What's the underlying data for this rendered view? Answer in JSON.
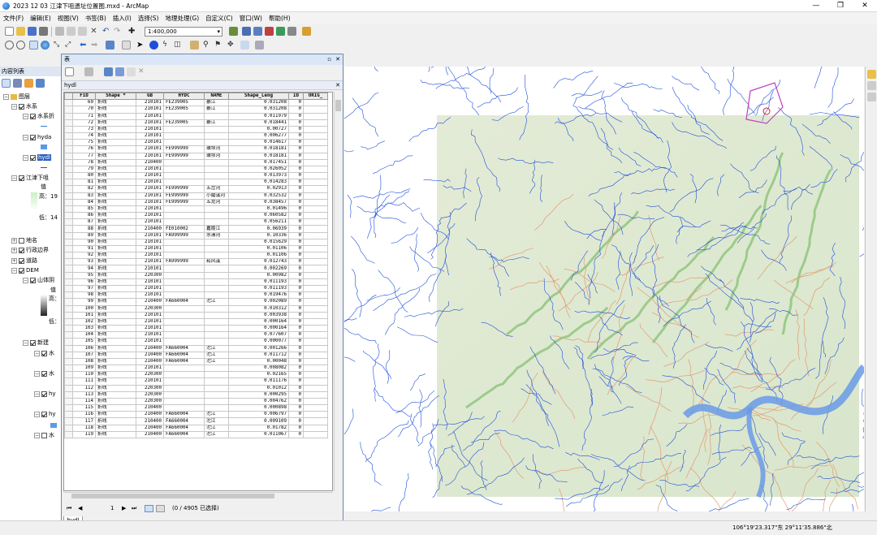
{
  "window": {
    "title": "2023 12 03 江津下咀遗址位置图.mxd - ArcMap"
  },
  "menu": [
    "文件(F)",
    "编辑(E)",
    "视图(V)",
    "书签(B)",
    "插入(I)",
    "选择(S)",
    "地理处理(G)",
    "自定义(C)",
    "窗口(W)",
    "帮助(H)"
  ],
  "toolbar": {
    "scale": "1:400,000"
  },
  "toc": {
    "title": "内容列表",
    "layers_root": "图层",
    "rows": [
      "水系",
      "水系折",
      "hyda",
      "hydl",
      "江津下咀",
      "值",
      "高：19",
      "低：14",
      "地名",
      "行政边界",
      "道路",
      "DEM",
      "山体阴",
      "值",
      "高：",
      "低：",
      "新建",
      "水",
      "水",
      "hy",
      "hy",
      "水"
    ]
  },
  "table": {
    "window_title": "表",
    "tab_name": "hydl",
    "columns": [
      "FID",
      "Shape *",
      "GB",
      "HYDC",
      "NAME",
      "Shape_Leng",
      "ID",
      "ORIG_"
    ],
    "rows": [
      [
        "69",
        "折线",
        "210101",
        "FE239005",
        "綦江",
        "0.031208",
        "0"
      ],
      [
        "70",
        "折线",
        "210101",
        "FE239005",
        "綦江",
        "0.031208",
        "0"
      ],
      [
        "71",
        "折线",
        "210101",
        "",
        "",
        "0.011979",
        "0"
      ],
      [
        "72",
        "折线",
        "210101",
        "FE239005",
        "綦江",
        "0.018441",
        "0"
      ],
      [
        "73",
        "折线",
        "210101",
        "",
        "",
        "0.00727",
        "0"
      ],
      [
        "74",
        "折线",
        "210101",
        "",
        "",
        "0.006277",
        "0"
      ],
      [
        "75",
        "折线",
        "210101",
        "",
        "",
        "0.014617",
        "0"
      ],
      [
        "76",
        "折线",
        "210101",
        "FE999999",
        "璜坝河",
        "0.018181",
        "0"
      ],
      [
        "77",
        "折线",
        "210101",
        "FE999999",
        "璜坝河",
        "0.018181",
        "0"
      ],
      [
        "78",
        "折线",
        "210400",
        "",
        "",
        "0.017451",
        "0"
      ],
      [
        "79",
        "折线",
        "210101",
        "",
        "",
        "0.026052",
        "0"
      ],
      [
        "80",
        "折线",
        "210101",
        "",
        "",
        "0.013973",
        "0"
      ],
      [
        "81",
        "折线",
        "210101",
        "",
        "",
        "0.014283",
        "0"
      ],
      [
        "82",
        "折线",
        "210101",
        "FE999999",
        "五岔河",
        "0.02913",
        "0"
      ],
      [
        "83",
        "折线",
        "210101",
        "FE999999",
        "小磨溪河",
        "0.032532",
        "0"
      ],
      [
        "84",
        "折线",
        "210101",
        "FE999999",
        "五龙河",
        "0.038457",
        "0"
      ],
      [
        "85",
        "折线",
        "210101",
        "",
        "",
        "0.01496",
        "0"
      ],
      [
        "86",
        "折线",
        "210101",
        "",
        "",
        "0.060582",
        "0"
      ],
      [
        "87",
        "折线",
        "210101",
        "",
        "",
        "0.056211",
        "0"
      ],
      [
        "88",
        "折线",
        "210400",
        "FE010002",
        "嘉陵江",
        "0.06939",
        "0"
      ],
      [
        "89",
        "折线",
        "210101",
        "FA999999",
        "水清河",
        "0.10336",
        "0"
      ],
      [
        "90",
        "折线",
        "210101",
        "",
        "",
        "0.015629",
        "0"
      ],
      [
        "91",
        "折线",
        "210101",
        "",
        "",
        "0.01106",
        "0"
      ],
      [
        "92",
        "折线",
        "210101",
        "",
        "",
        "0.01106",
        "0"
      ],
      [
        "93",
        "折线",
        "210101",
        "FA999999",
        "菘风溪",
        "0.012743",
        "0"
      ],
      [
        "94",
        "折线",
        "210101",
        "",
        "",
        "0.002269",
        "0"
      ],
      [
        "95",
        "折线",
        "220300",
        "",
        "",
        "0.00982",
        "0"
      ],
      [
        "96",
        "折线",
        "210101",
        "",
        "",
        "0.011193",
        "0"
      ],
      [
        "97",
        "折线",
        "210101",
        "",
        "",
        "0.011193",
        "0"
      ],
      [
        "98",
        "折线",
        "210101",
        "",
        "",
        "0.019476",
        "0"
      ],
      [
        "99",
        "折线",
        "210400",
        "FA660004",
        "沱江",
        "0.002089",
        "0"
      ],
      [
        "100",
        "折线",
        "220300",
        "",
        "",
        "0.010312",
        "0"
      ],
      [
        "101",
        "折线",
        "210101",
        "",
        "",
        "0.003938",
        "0"
      ],
      [
        "102",
        "折线",
        "210101",
        "",
        "",
        "0.000164",
        "0"
      ],
      [
        "103",
        "折线",
        "210101",
        "",
        "",
        "0.000164",
        "0"
      ],
      [
        "104",
        "折线",
        "210101",
        "",
        "",
        "0.077607",
        "0"
      ],
      [
        "105",
        "折线",
        "210101",
        "",
        "",
        "0.000077",
        "0"
      ],
      [
        "106",
        "折线",
        "210400",
        "FA660004",
        "沱江",
        "0.001266",
        "0"
      ],
      [
        "107",
        "折线",
        "210400",
        "FA660004",
        "沱江",
        "0.011712",
        "0"
      ],
      [
        "108",
        "折线",
        "210400",
        "FA660004",
        "沱江",
        "0.00048",
        "0"
      ],
      [
        "109",
        "折线",
        "210101",
        "",
        "",
        "0.008082",
        "0"
      ],
      [
        "110",
        "折线",
        "220300",
        "",
        "",
        "0.02165",
        "0"
      ],
      [
        "111",
        "折线",
        "210101",
        "",
        "",
        "0.011176",
        "0"
      ],
      [
        "112",
        "折线",
        "220300",
        "",
        "",
        "0.01012",
        "0"
      ],
      [
        "113",
        "折线",
        "220300",
        "",
        "",
        "0.000295",
        "0"
      ],
      [
        "114",
        "折线",
        "220300",
        "",
        "",
        "0.004762",
        "0"
      ],
      [
        "115",
        "折线",
        "210400",
        "",
        "",
        "0.000898",
        "0"
      ],
      [
        "116",
        "折线",
        "210400",
        "FA660004",
        "沱江",
        "0.006797",
        "0"
      ],
      [
        "117",
        "折线",
        "210400",
        "FA660004",
        "沱江",
        "0.009109",
        "0"
      ],
      [
        "118",
        "折线",
        "210400",
        "FA660004",
        "沱江",
        "0.01782",
        "0"
      ],
      [
        "119",
        "折线",
        "210400",
        "FA660004",
        "沱江",
        "0.011067",
        "0"
      ]
    ],
    "nav": {
      "record": "1",
      "selection_text": "(0 / 4905 已选择)"
    },
    "bottom_tab": "hydl"
  },
  "status": {
    "coords": "106°19'23.317\"东  29°11'35.886\"北"
  },
  "colors": {
    "water": "#1e4fd8",
    "road": "#e0946a",
    "terrain": "#dde8d0",
    "ridge": "#7fbf6a"
  }
}
